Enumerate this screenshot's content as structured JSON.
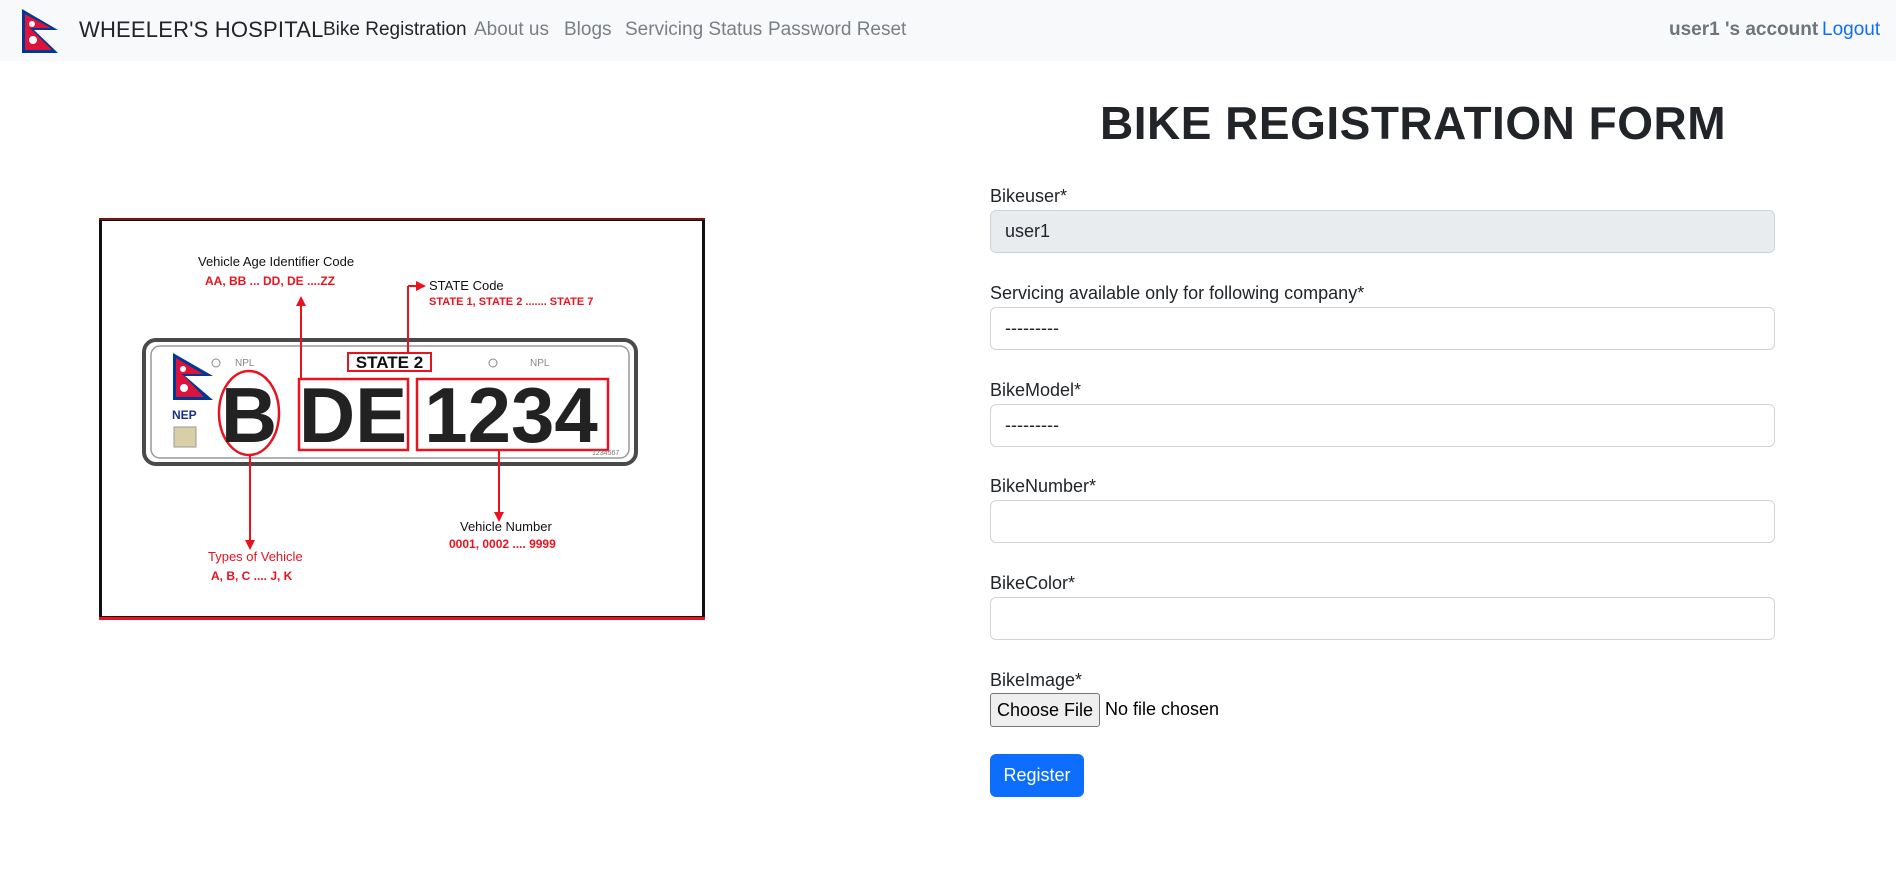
{
  "navbar": {
    "brand": "WHEELER'S HOSPITAL",
    "links": [
      "Bike Registration",
      "About us",
      "Blogs",
      "Servicing Status",
      "Password Reset"
    ],
    "account": "user1 's account",
    "logout": "Logout"
  },
  "plate_image": {
    "age_code_title": "Vehicle Age Identifier Code",
    "age_code_values": "AA, BB ... DD, DE ....ZZ",
    "state_code_title": "STATE Code",
    "state_code_values": "STATE 1, STATE 2 ....... STATE 7",
    "plate_state": "STATE 2",
    "plate_npl_1": "NPL",
    "plate_npl_2": "NPL",
    "plate_nep": "NEP",
    "plate_letter": "B",
    "plate_code": "DE",
    "plate_number": "1234",
    "plate_serial": "1234567",
    "vehicle_number_title": "Vehicle Number",
    "vehicle_number_values": "0001, 0002 .... 9999",
    "types_title": "Types of Vehicle",
    "types_values": "A, B, C .... J, K"
  },
  "form": {
    "title": "BIKE REGISTRATION FORM",
    "fields": [
      {
        "label": "Bikeuser*",
        "value": "user1"
      },
      {
        "label": "Servicing available only for following company*",
        "value": "---------"
      },
      {
        "label": "BikeModel*",
        "value": "---------"
      },
      {
        "label": "BikeNumber*",
        "value": ""
      },
      {
        "label": "BikeColor*",
        "value": ""
      }
    ],
    "image_label": "BikeImage*",
    "file_button": "Choose File",
    "file_status": "No file chosen",
    "submit": "Register"
  },
  "colors": {
    "navbar_bg": "#f8f9fa",
    "primary": "#0d6efd",
    "annotation_red": "#e8131f",
    "flag_red": "#dc143c",
    "flag_blue": "#003893"
  }
}
